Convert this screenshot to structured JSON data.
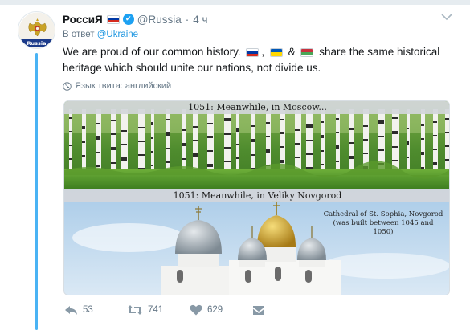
{
  "tweet": {
    "display_name": "РоссиЯ",
    "handle": "@Russia",
    "dot": "·",
    "time": "4 ч",
    "avatar_label": "Russia",
    "reply_prefix": "В ответ ",
    "reply_mention": "@Ukraine",
    "text_part1": "We are proud of our common history.",
    "text_comma": ",",
    "text_amp": "&",
    "text_part2": "share the same historical heritage which should unite our nations, not divide us.",
    "translate_label": "Язык твита: английский"
  },
  "media": {
    "caption_top": "1051: Meanwhile, in Moscow...",
    "caption_bottom": "1051: Meanwhile, in Veliky Novgorod",
    "cathedral_line1": "Cathedral of St. Sophia, Novgorod",
    "cathedral_line2": "(was built between 1045 and 1050)"
  },
  "actions": {
    "replies": "53",
    "retweets": "741",
    "likes": "629"
  },
  "icons": {
    "reply": "reply-icon",
    "retweet": "retweet-icon",
    "like": "heart-icon",
    "dm": "envelope-icon",
    "verified": "verified-badge-icon",
    "caret": "chevron-down-icon",
    "translate": "globe-icon"
  },
  "colors": {
    "accent": "#1b95e0",
    "verified": "#1da1f2",
    "thread_line": "#4ab3f4",
    "muted": "#657786",
    "flag_ru": [
      "#ffffff",
      "#0039a6",
      "#d52b1e"
    ],
    "flag_ua": [
      "#0057b7",
      "#ffd700"
    ],
    "flag_by": [
      "#c8313e",
      "#4aa657",
      "#ffffff"
    ]
  }
}
